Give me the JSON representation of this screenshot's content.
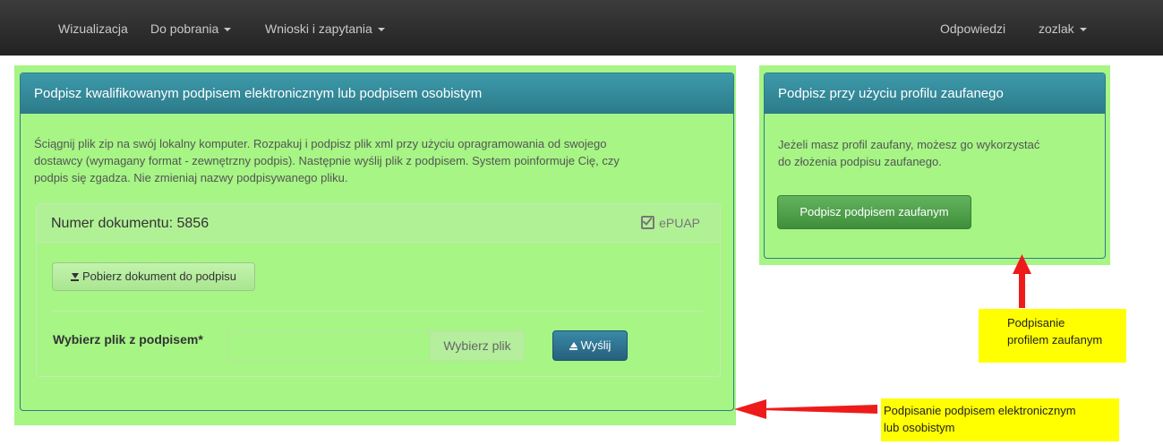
{
  "navbar": {
    "items": [
      "Wizualizacja",
      "Do pobrania",
      "Wnioski i zapytania"
    ],
    "right_items": [
      "Odpowiedzi",
      "zozlak"
    ]
  },
  "qualified_panel": {
    "heading": "Podpisz kwalifikowanym podpisem elektronicznym lub podpisem osobistym",
    "description": [
      "Ściągnij plik zip na swój lokalny komputer. Rozpakuj i podpisz plik xml przy użyciu opragramowania od swojego",
      "dostawcy (wymagany format - zewnętrzny podpis). Następnie wyślij plik z podpisem. System poinformuje Cię, czy",
      "podpis się zgadza. Nie zmieniaj nazwy podpisywanego pliku."
    ],
    "document": {
      "title": "Numer dokumentu: 5856",
      "epuap_label": "ePUAP",
      "download_label": "Pobierz dokument do podpisu",
      "file_label": "Wybierz plik z podpisem*",
      "file_input_value": "",
      "choose_file_label": "Wybierz plik",
      "send_label": "Wyślij"
    }
  },
  "trusted_panel": {
    "heading": "Podpisz przy użyciu profilu zaufanego",
    "description": [
      "Jeżeli masz profil zaufany, możesz go wykorzystać",
      "do złożenia podpisu zaufanego."
    ],
    "button_label": "Podpisz podpisem zaufanym"
  },
  "annotations": {
    "trusted_note": [
      "Podpisanie",
      "profilem zaufanym"
    ],
    "qualified_note": [
      "Podpisanie podpisem elektronicznym",
      "lub osobistym"
    ],
    "arrow_color": "#ee1b1b",
    "highlight_color": "#a6f585"
  }
}
